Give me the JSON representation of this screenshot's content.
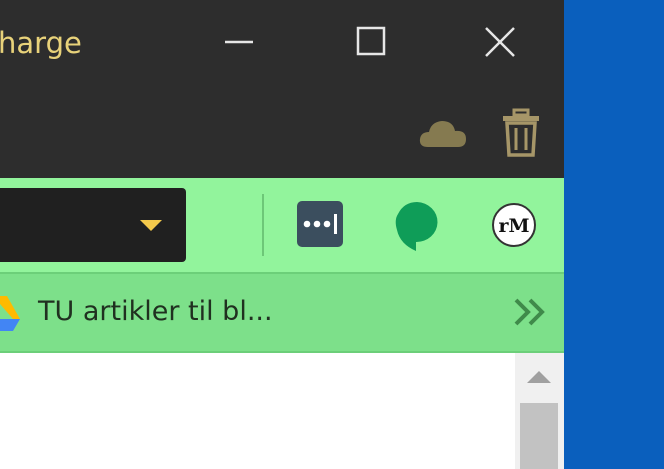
{
  "window": {
    "title_fragment": "harge"
  },
  "bookmarks": {
    "items": [
      {
        "label": "TU artikler til bl...",
        "icon": "google-drive-icon"
      }
    ],
    "overflow_icon": "chevron-double-right-icon"
  },
  "toolbar": {
    "extensions": [
      {
        "icon": "lastpass-icon"
      },
      {
        "icon": "hangouts-icon"
      },
      {
        "icon": "rm-icon",
        "text": "rM"
      }
    ]
  },
  "colors": {
    "titlebar": "#2d2d2d",
    "title_text": "#e8d27a",
    "toolbar": "#92f49c",
    "bookmarks_bar": "#7de08a",
    "desktop": "#0a5fbd",
    "dropdown_caret": "#f4c94b"
  }
}
